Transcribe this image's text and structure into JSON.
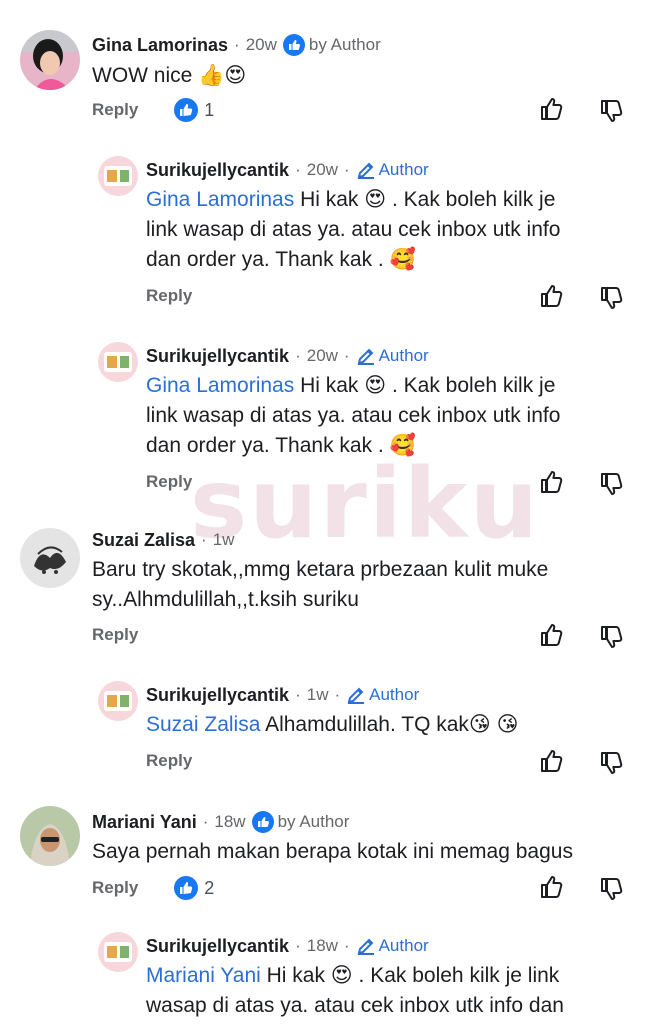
{
  "watermark": "suriku",
  "comments": [
    {
      "name": "Gina Lamorinas",
      "time": "20w",
      "badge": "by Author",
      "text": "WOW nice",
      "emoji": "👍😍",
      "reply_label": "Reply",
      "reactions": "1"
    },
    {
      "name": "Surikujellycantik",
      "time": "20w",
      "badge": "Author",
      "mention": "Gina Lamorinas",
      "line1": " Hi kak 😍 . Kak boleh kilk je",
      "line2": "link wasap di atas ya. atau cek inbox utk info",
      "line3": "dan order ya. Thank kak . 🥰",
      "reply_label": "Reply"
    },
    {
      "name": "Surikujellycantik",
      "time": "20w",
      "badge": "Author",
      "mention": "Gina Lamorinas",
      "line1": " Hi kak 😍 . Kak boleh kilk je",
      "line2": "link wasap di atas ya. atau cek inbox utk info",
      "line3": "dan order ya. Thank kak . 🥰",
      "reply_label": "Reply"
    },
    {
      "name": "Suzai Zalisa",
      "time": "1w",
      "line1": "Baru try skotak,,mmg ketara prbezaan kulit muke",
      "line2": "sy..Alhmdulillah,,t.ksih suriku",
      "reply_label": "Reply"
    },
    {
      "name": "Surikujellycantik",
      "time": "1w",
      "badge": "Author",
      "mention": "Suzai Zalisa",
      "line1": " Alhamdulillah. TQ kak😘 😘",
      "reply_label": "Reply"
    },
    {
      "name": "Mariani Yani",
      "time": "18w",
      "badge": "by Author",
      "line1": "Saya pernah makan berapa kotak ini memag bagus",
      "reply_label": "Reply",
      "reactions": "2"
    },
    {
      "name": "Surikujellycantik",
      "time": "18w",
      "badge": "Author",
      "mention": "Mariani Yani",
      "line1": " Hi kak 😍 . Kak boleh kilk je link",
      "line2": "wasap di atas ya. atau cek inbox utk info dan"
    }
  ],
  "colors": {
    "link": "#2b6fd6",
    "meta": "#65676b",
    "like": "#1877f2"
  },
  "icons": [
    "thumbs-up-icon",
    "thumbs-down-icon",
    "pencil-icon",
    "like-reaction-icon"
  ]
}
